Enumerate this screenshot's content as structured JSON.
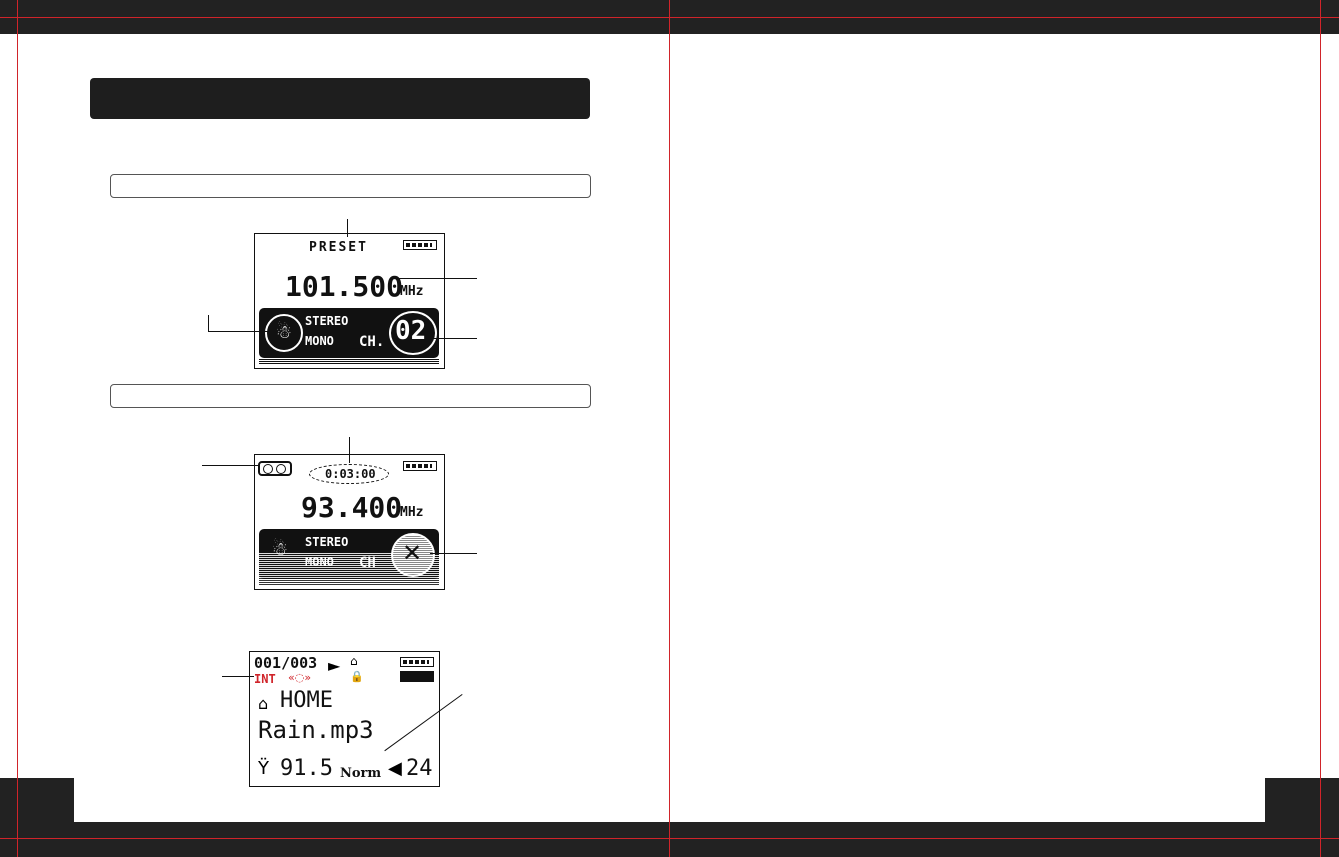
{
  "screen1": {
    "preset": "PRESET",
    "frequency": "101.500",
    "unit": "MHz",
    "stereo": "STEREO",
    "mono": "MONO",
    "ch": "CH.",
    "channel": "02"
  },
  "screen2": {
    "timer": "0:03:00",
    "frequency": "93.400",
    "unit": "MHz",
    "stereo": "STEREO",
    "mono": "MONO",
    "ch": "CH"
  },
  "screen3": {
    "track_counter": "001/003",
    "source": "INT",
    "folder": "HOME",
    "filename": "Rain.mp3",
    "fm_freq": "91.5",
    "eq_mode": "Norm",
    "volume": "24"
  },
  "colors": {
    "crop_marks": "#d0242a",
    "header_bar": "#1e1e1e",
    "int_label": "#d0242a"
  }
}
